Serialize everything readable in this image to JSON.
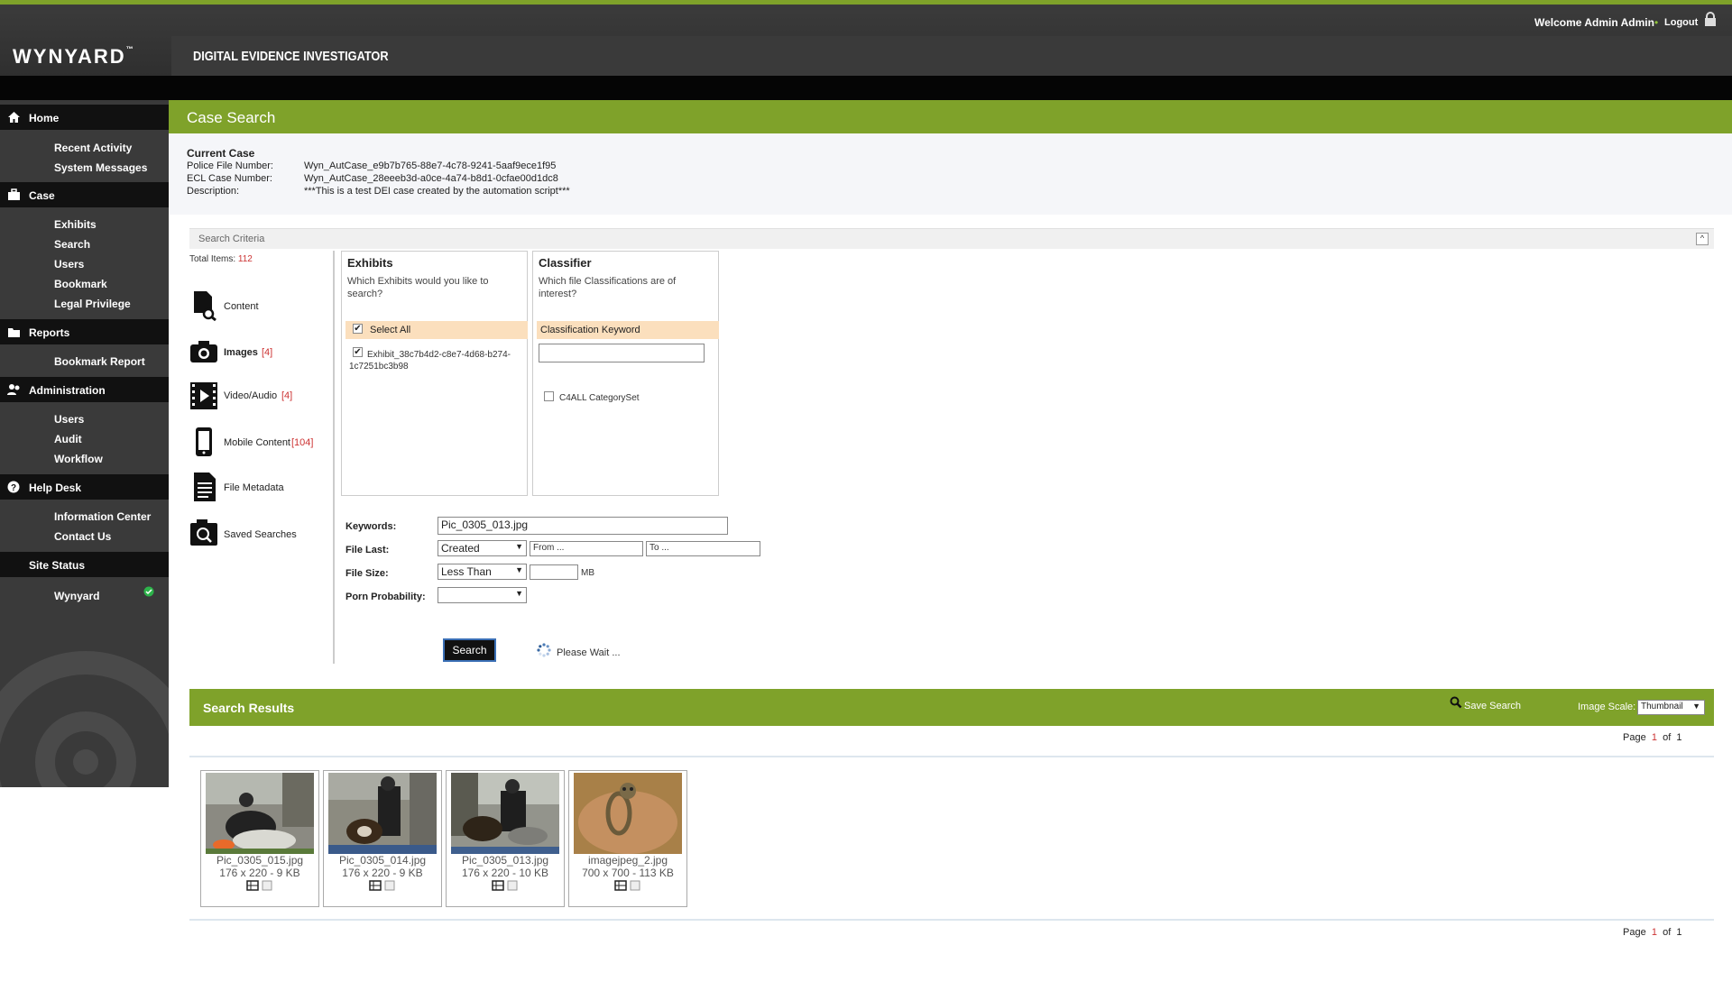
{
  "header": {
    "logo": "WYNYARD",
    "logo_tm": "™",
    "app_title": "DIGITAL EVIDENCE INVESTIGATOR",
    "welcome": "Welcome Admin Admin",
    "separator": "•",
    "logout": "Logout"
  },
  "sidebar": {
    "home": {
      "label": "Home",
      "items": [
        "Recent Activity",
        "System Messages"
      ]
    },
    "case": {
      "label": "Case",
      "items": [
        "Exhibits",
        "Search",
        "Users",
        "Bookmark",
        "Legal Privilege"
      ]
    },
    "reports": {
      "label": "Reports",
      "items": [
        "Bookmark Report"
      ]
    },
    "administration": {
      "label": "Administration",
      "items": [
        "Users",
        "Audit",
        "Workflow"
      ]
    },
    "helpdesk": {
      "label": "Help Desk",
      "items": [
        "Information Center",
        "Contact Us"
      ]
    },
    "site_status": {
      "label": "Site Status",
      "items": [
        "Wynyard"
      ],
      "status_color": "#2db34a"
    }
  },
  "page": {
    "title": "Case Search"
  },
  "case_info": {
    "heading": "Current Case",
    "police_label": "Police File Number:",
    "police_value": "Wyn_AutCase_e9b7b765-88e7-4c78-9241-5aaf9ece1f95",
    "ecl_label": "ECL Case Number:",
    "ecl_value": "Wyn_AutCase_28eeeb3d-a0ce-4a74-b8d1-0cfae00d1dc8",
    "desc_label": "Description:",
    "desc_value": "***This is a test DEI case created by the automation script***"
  },
  "criteria": {
    "bar_label": "Search Criteria",
    "collapse": "^",
    "total_label": "Total Items:",
    "total_value": "112",
    "categories": {
      "content": {
        "label": "Content",
        "count": ""
      },
      "images": {
        "label": "Images",
        "count": "[4]"
      },
      "video": {
        "label": "Video/Audio",
        "count": "[4]"
      },
      "mobile": {
        "label": "Mobile Content",
        "count": "[104]"
      },
      "metadata": {
        "label": "File Metadata",
        "count": ""
      },
      "saved": {
        "label": "Saved Searches",
        "count": ""
      }
    }
  },
  "exhibits_panel": {
    "title": "Exhibits",
    "desc": "Which Exhibits would you like to search?",
    "select_all": "Select All",
    "exhibit": "Exhibit_38c7b4d2-c8e7-4d68-b274-1c7251bc3b98"
  },
  "classifier_panel": {
    "title": "Classifier",
    "desc": "Which file Classifications are of interest?",
    "keyword_label": "Classification Keyword",
    "keyword_value": "",
    "category_set": "C4ALL CategorySet"
  },
  "form": {
    "keywords_label": "Keywords:",
    "keywords_value": "Pic_0305_013.jpg",
    "file_last_label": "File Last:",
    "file_last_value": "Created",
    "from_placeholder": "From ...",
    "to_placeholder": "To ...",
    "file_size_label": "File Size:",
    "file_size_value": "Less Than",
    "size_value": "",
    "size_unit": "MB",
    "porn_label": "Porn Probability:",
    "porn_value": "",
    "search_button": "Search",
    "wait_text": "Please Wait ..."
  },
  "results": {
    "title": "Search Results",
    "save_search": "Save Search",
    "scale_label": "Image Scale:",
    "scale_value": "Thumbnail",
    "page_label": "Page",
    "page_current": "1",
    "page_of": "of",
    "page_total": "1",
    "thumbnails": [
      {
        "name": "Pic_0305_015.jpg",
        "meta": "176 x 220 - 9 KB"
      },
      {
        "name": "Pic_0305_014.jpg",
        "meta": "176 x 220 - 9 KB"
      },
      {
        "name": "Pic_0305_013.jpg",
        "meta": "176 x 220 - 10 KB"
      },
      {
        "name": "imagejpeg_2.jpg",
        "meta": "700 x 700 - 113 KB"
      }
    ]
  },
  "colors": {
    "accent_green": "#7fa22a",
    "sidebar_bg": "#3a3a3a",
    "section_bg": "#111111",
    "highlight_orange": "#fbdfbd",
    "count_red": "#cc3333"
  }
}
